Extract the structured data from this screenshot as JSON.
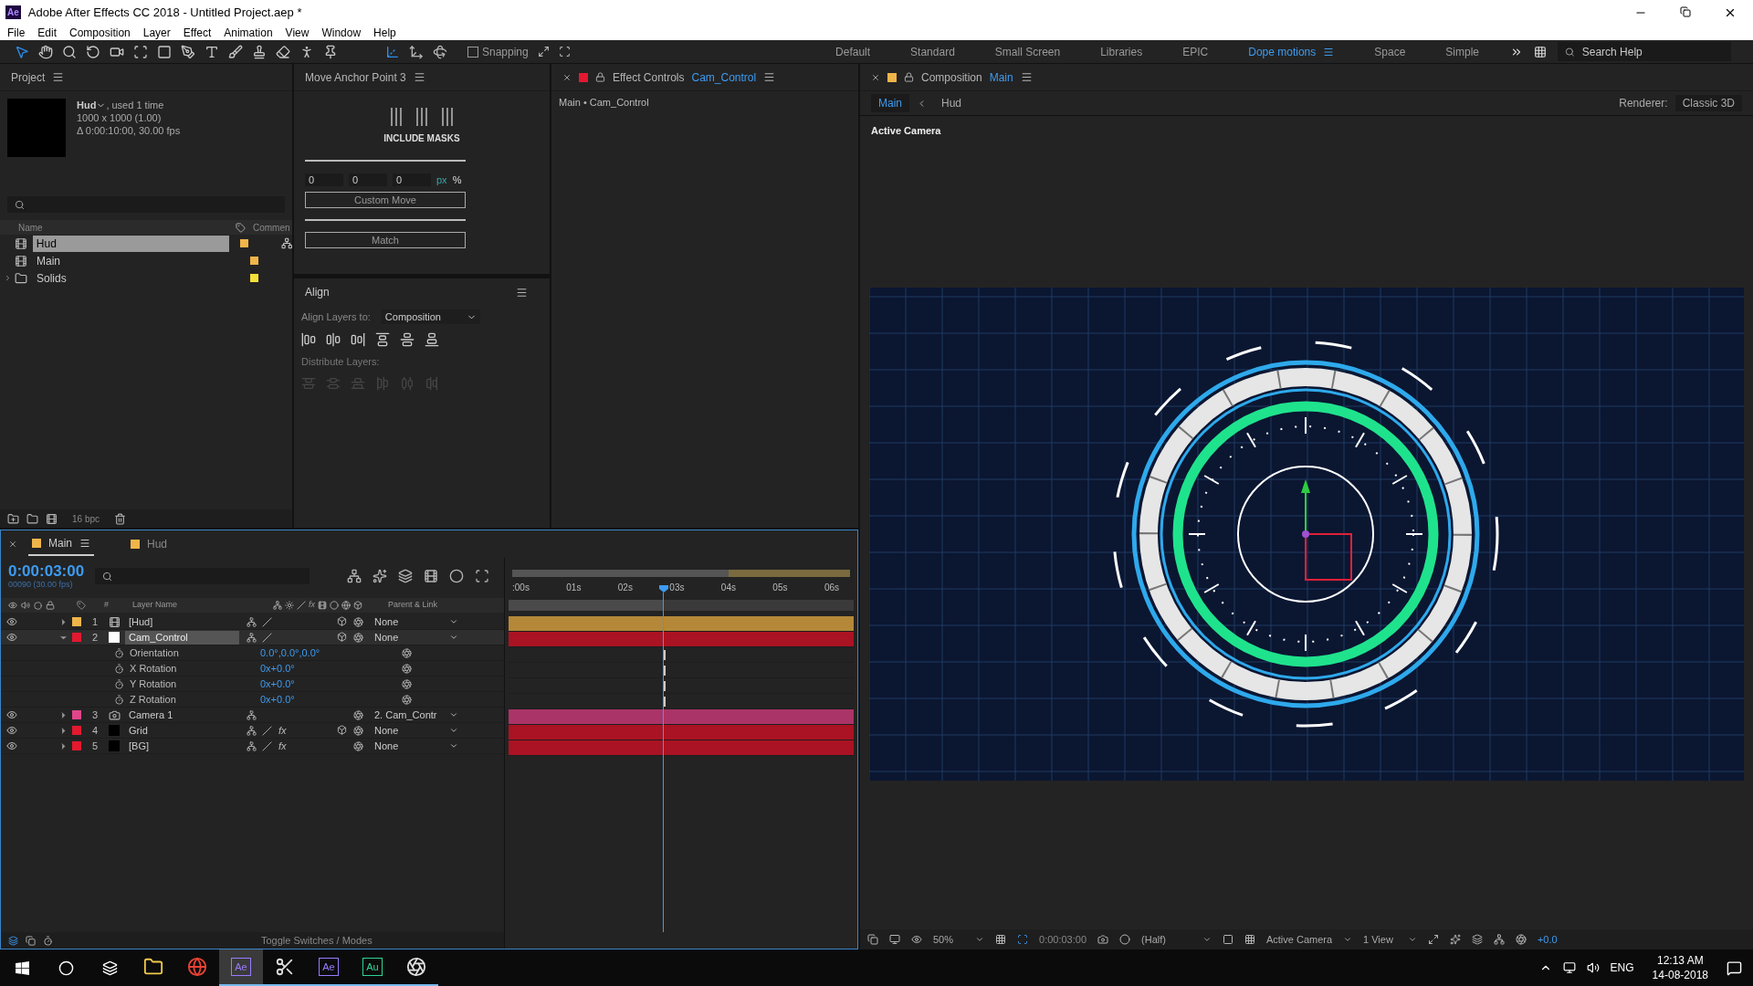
{
  "window": {
    "title": "Adobe After Effects CC 2018 - Untitled Project.aep *",
    "app_badge": "Ae"
  },
  "menu": [
    "File",
    "Edit",
    "Composition",
    "Layer",
    "Effect",
    "Animation",
    "View",
    "Window",
    "Help"
  ],
  "toolbar": {
    "snapping": {
      "label": "Snapping",
      "checked": false
    }
  },
  "workspaces": [
    {
      "label": "Default",
      "selected": false
    },
    {
      "label": "Standard",
      "selected": false
    },
    {
      "label": "Small Screen",
      "selected": false
    },
    {
      "label": "Libraries",
      "selected": false
    },
    {
      "label": "EPIC",
      "selected": false
    },
    {
      "label": "Dope motions",
      "selected": true
    },
    {
      "label": "Space",
      "selected": false
    },
    {
      "label": "Simple",
      "selected": false
    }
  ],
  "search_help": {
    "placeholder": "Search Help"
  },
  "project": {
    "title": "Project",
    "info": {
      "name": "Hud",
      "used": ", used 1 time",
      "size": "1000 x 1000 (1.00)",
      "duration": "Δ 0:00:10:00, 30.00 fps"
    },
    "columns": [
      "Name",
      "Commen"
    ],
    "items": [
      {
        "name": "Hud",
        "kind": "comp",
        "selected": true,
        "color": "#f0b54a"
      },
      {
        "name": "Main",
        "kind": "comp",
        "selected": false,
        "color": "#f0b54a"
      },
      {
        "name": "Solids",
        "kind": "folder",
        "selected": false,
        "color": "#f4e03a"
      }
    ],
    "bpc": "16 bpc"
  },
  "move_anchor": {
    "title": "Move Anchor Point 3",
    "include": "INCLUDE MASKS",
    "fields": [
      "0",
      "0",
      "0"
    ],
    "units": [
      {
        "label": "px",
        "selected": true
      },
      {
        "label": "%",
        "selected": false
      }
    ],
    "buttons": [
      "Custom Move",
      "Match"
    ]
  },
  "align": {
    "title": "Align",
    "align_to_label": "Align Layers to:",
    "align_to": "Composition",
    "distribute_label": "Distribute Layers:"
  },
  "effect_controls": {
    "title": "Effect Controls",
    "layer": "Cam_Control",
    "path": "Main • Cam_Control"
  },
  "composition": {
    "title": "Composition",
    "name": "Main",
    "breadcrumbs": [
      {
        "label": "Main",
        "selected": true
      },
      {
        "label": "Hud",
        "selected": false
      }
    ],
    "renderer_label": "Renderer:",
    "renderer": "Classic 3D",
    "view_label": "Active Camera",
    "footer": {
      "zoom": "50%",
      "time": "0:00:03:00",
      "resolution": "(Half)",
      "camera": "Active Camera",
      "views": "1 View",
      "exposure": "+0.0"
    }
  },
  "timeline": {
    "tabs": [
      {
        "label": "Main",
        "selected": true,
        "color": "#f0b54a"
      },
      {
        "label": "Hud",
        "selected": false,
        "color": "#f0b54a"
      }
    ],
    "time": "0:00:03:00",
    "frames": "00090 (30.00 fps)",
    "columns": {
      "number": "#",
      "name": "Layer Name",
      "fx": "fx",
      "parent": "Parent & Link"
    },
    "ruler": [
      ":00s",
      "01s",
      "02s",
      "03s",
      "04s",
      "05s",
      "06s"
    ],
    "playhead": {
      "level": 0.45
    },
    "layers": [
      {
        "number": "1",
        "name": "[Hud]",
        "kind": "comp",
        "color": "#f0b54a",
        "expanded": false,
        "selected": false,
        "parent": "None",
        "threed": true
      },
      {
        "number": "2",
        "name": "Cam_Control",
        "kind": "null",
        "color": "#e2192f",
        "expanded": true,
        "selected": true,
        "parent": "None",
        "threed": true,
        "properties": [
          {
            "name": "Orientation",
            "value": "0.0°,0.0°,0.0°"
          },
          {
            "name": "X Rotation",
            "value": "0x+0.0°"
          },
          {
            "name": "Y Rotation",
            "value": "0x+0.0°"
          },
          {
            "name": "Z Rotation",
            "value": "0x+0.0°"
          }
        ]
      },
      {
        "number": "3",
        "name": "Camera 1",
        "kind": "camera",
        "color": "#e2458a",
        "expanded": false,
        "selected": false,
        "parent": "2. Cam_Contr",
        "threed": false
      },
      {
        "number": "4",
        "name": "Grid",
        "kind": "solid",
        "color": "#e2192f",
        "expanded": false,
        "selected": false,
        "parent": "None",
        "threed": true,
        "fx": "fx"
      },
      {
        "number": "5",
        "name": "[BG]",
        "kind": "solid",
        "color": "#e2192f",
        "expanded": false,
        "selected": false,
        "parent": "None",
        "threed": false,
        "fx": "fx"
      }
    ],
    "footer": "Toggle Switches / Modes"
  },
  "taskbar": {
    "apps": [
      {
        "kind": "explorer",
        "running": false,
        "selected": false
      },
      {
        "kind": "chrome",
        "running": false,
        "selected": false
      },
      {
        "kind": "letter",
        "label": "Ae",
        "running": true,
        "selected": true,
        "color": "#9a7bff"
      },
      {
        "kind": "snip",
        "running": true,
        "selected": false
      },
      {
        "kind": "letter",
        "label": "Ae",
        "running": true,
        "selected": false,
        "color": "#9a7bff"
      },
      {
        "kind": "letter",
        "label": "Au",
        "running": true,
        "selected": false,
        "color": "#2fd49a"
      },
      {
        "kind": "obs",
        "running": true,
        "selected": false
      }
    ],
    "language": "ENG",
    "time": "12:13 AM",
    "date": "14-08-2018"
  }
}
